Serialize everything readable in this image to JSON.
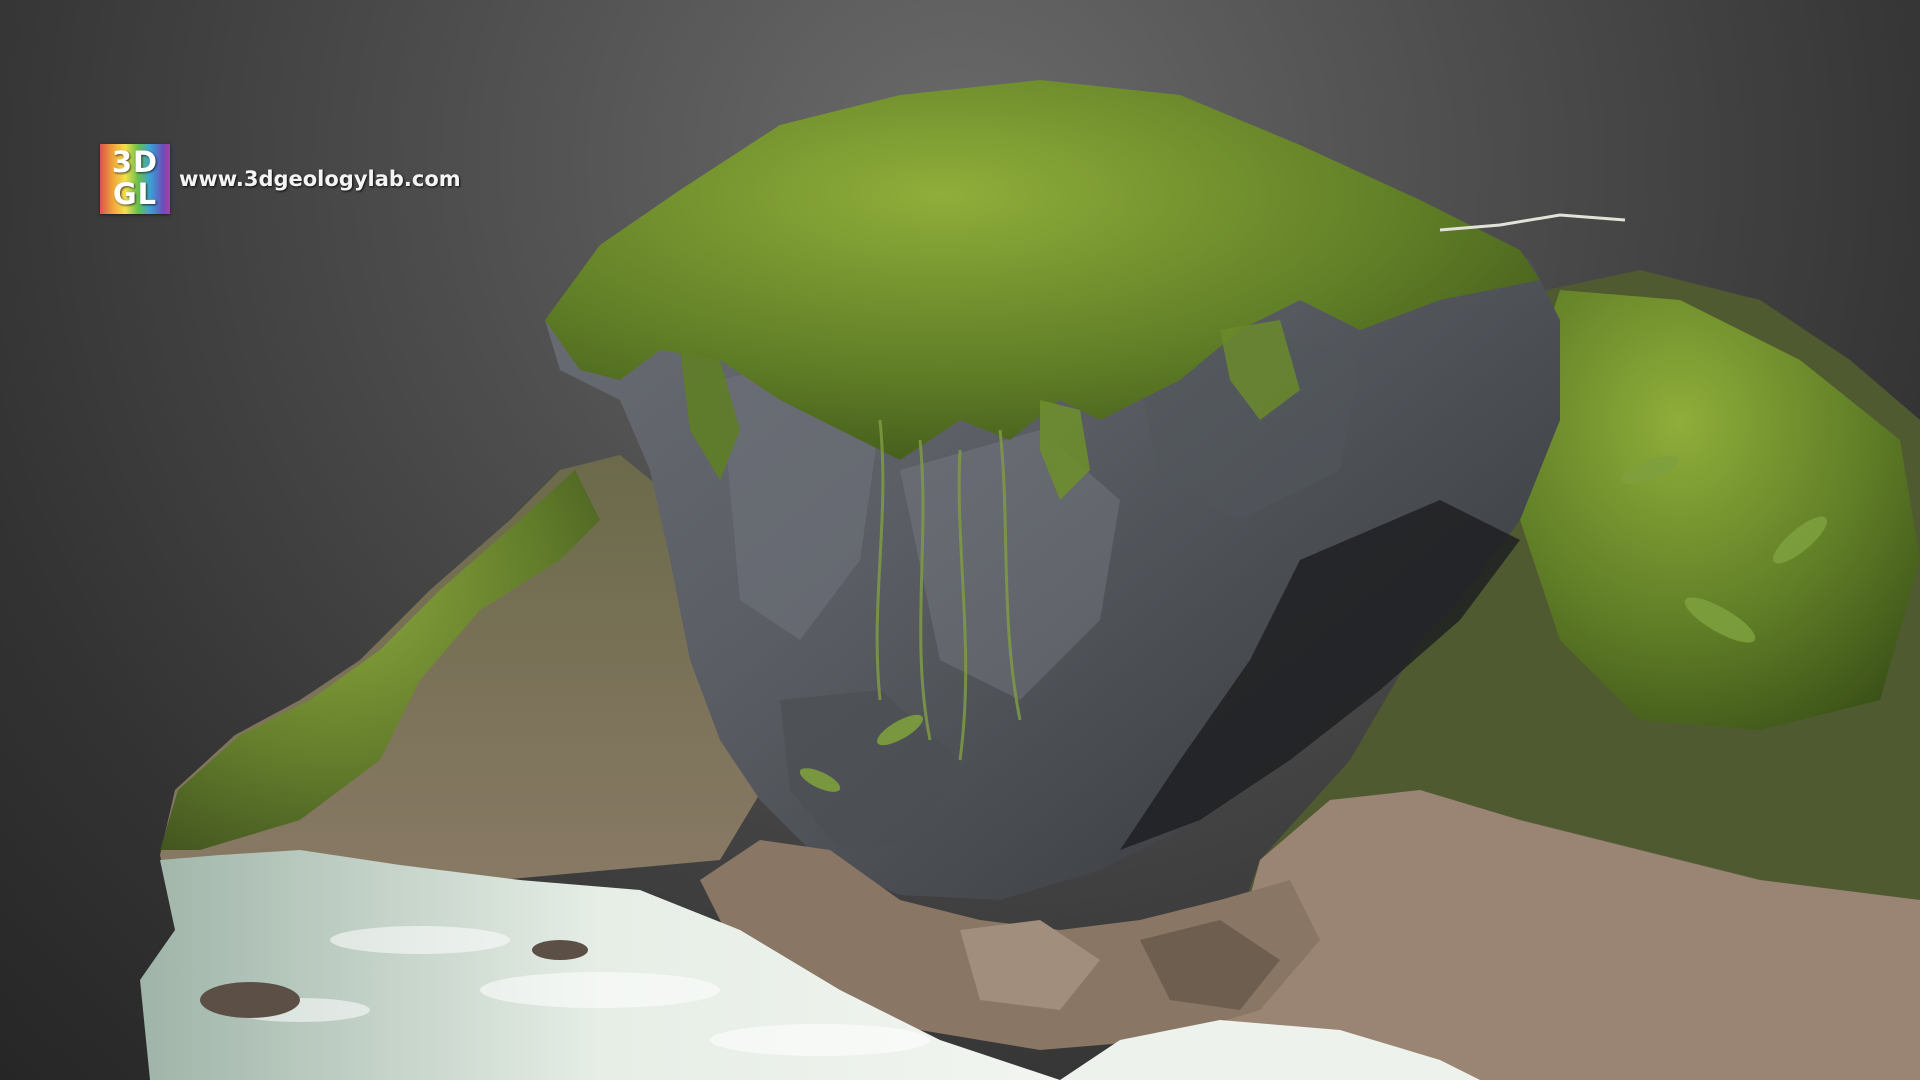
{
  "logo": {
    "line1": "3D",
    "line2": "GL",
    "url": "www.3dgeologylab.com"
  },
  "colors": {
    "background": "#4c4c4c",
    "rock": "#5e6268",
    "moss": "#6f8f2c",
    "water": "#d8e4da"
  },
  "scene": {
    "subject": "moss-covered limestone boulder beside a stream (3D model render)"
  }
}
